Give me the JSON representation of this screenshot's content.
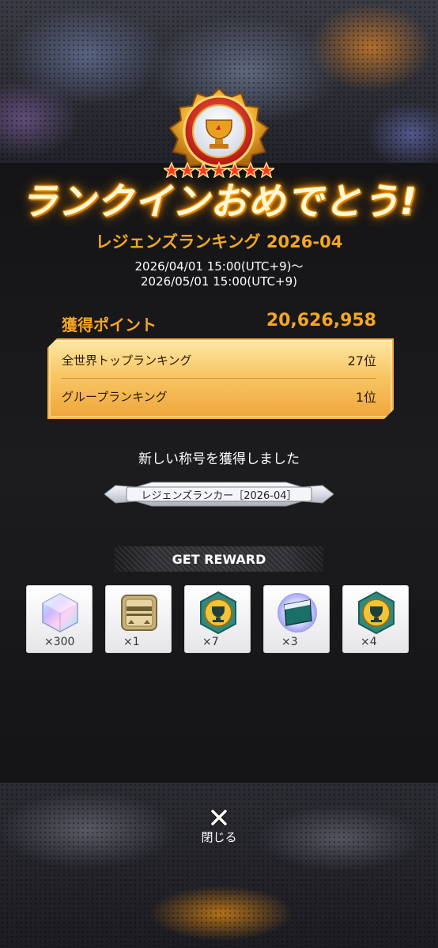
{
  "header": {
    "congrats": "ランクインおめでとう!"
  },
  "event": {
    "title": "レジェンズランキング 2026-04",
    "period_start": "2026/04/01 15:00(UTC+9)～",
    "period_end": "2026/05/01 15:00(UTC+9)"
  },
  "points": {
    "label": "獲得ポイント",
    "value": "20,626,958"
  },
  "rankings": [
    {
      "label": "全世界トップランキング",
      "value": "27位"
    },
    {
      "label": "グループランキング",
      "value": "1位"
    }
  ],
  "new_title": {
    "message": "新しい称号を獲得しました",
    "name": "レジェンズランカー［2026-04］"
  },
  "reward": {
    "header": "GET REWARD",
    "items": [
      {
        "icon": "rainbow-crystal-icon",
        "qty": "×300"
      },
      {
        "icon": "gold-ticket-icon",
        "qty": "×1"
      },
      {
        "icon": "trophy-medal-icon",
        "qty": "×7"
      },
      {
        "icon": "card-pack-icon",
        "qty": "×3"
      },
      {
        "icon": "trophy-medal-icon",
        "qty": "×4"
      }
    ]
  },
  "close": {
    "label": "閉じる"
  },
  "colors": {
    "accent": "#f5a623",
    "panel_gold": "#f8c765"
  }
}
